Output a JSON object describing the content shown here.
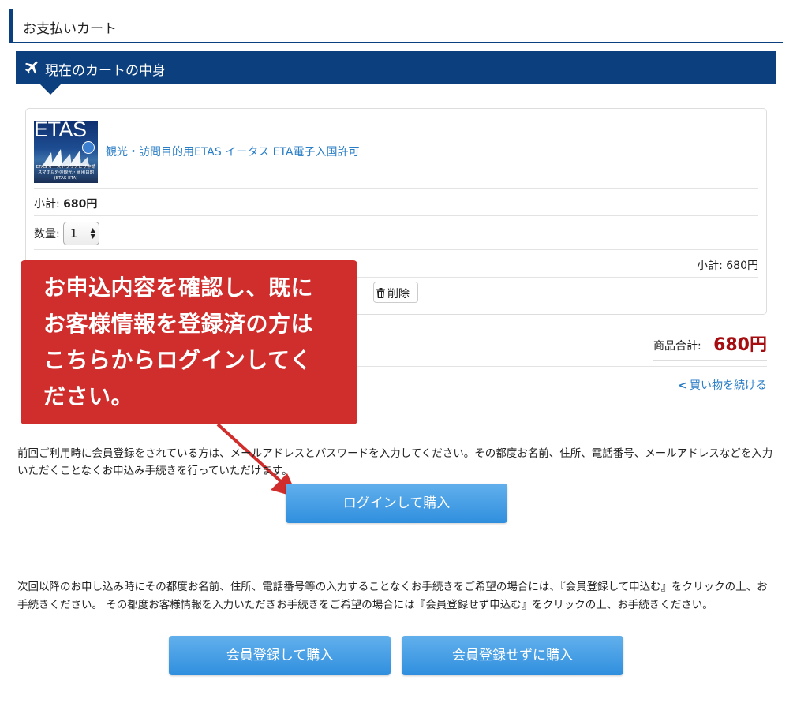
{
  "header": {
    "title": "お支払いカート"
  },
  "section": {
    "title": "現在のカートの中身",
    "icon": "airplane-icon"
  },
  "product": {
    "image_text": "ETAS",
    "image_caption": "ETAS オーストラリアビザ申請 スマホ以外の観光・商用目的(ETAS ETA)",
    "name": "観光・訪問目的用ETAS イータス ETA電子入国許可",
    "subtotal_label": "小計:",
    "subtotal_value": "680円",
    "qty_label": "数量:",
    "qty_value": "1",
    "line_subtotal": "小計: 680円",
    "delete_label": "削除"
  },
  "cart": {
    "total_label": "商品合計:",
    "total_value": "680円",
    "continue_label": "買い物を続ける"
  },
  "callout": {
    "lines": [
      "お申込内容を確認し、既に",
      "お客様情報を登録済の方は",
      "こちらからログインしてく",
      "ださい。"
    ]
  },
  "login": {
    "info": "前回ご利用時に会員登録をされている方は、メールアドレスとパスワードを入力してください。その都度お名前、住所、電話番号、メールアドレスなどを入力いただくことなくお申込み手続きを行っていただけます。",
    "button": "ログインして購入"
  },
  "register": {
    "info": "次回以降のお申し込み時にその都度お名前、住所、電話番号等の入力することなくお手続きをご希望の場合には、『会員登録して申込む』をクリックの上、お手続きください。 その都度お客様情報を入力いただきお手続きをご希望の場合には『会員登録せず申込む』をクリックの上、お手続きください。",
    "register_button": "会員登録して購入",
    "guest_button": "会員登録せずに購入"
  },
  "colors": {
    "navy": "#0b3f7e",
    "link": "#2a7ec6",
    "price": "#a50d10",
    "callout": "#d02e2c",
    "button": "#3d9ae2"
  }
}
